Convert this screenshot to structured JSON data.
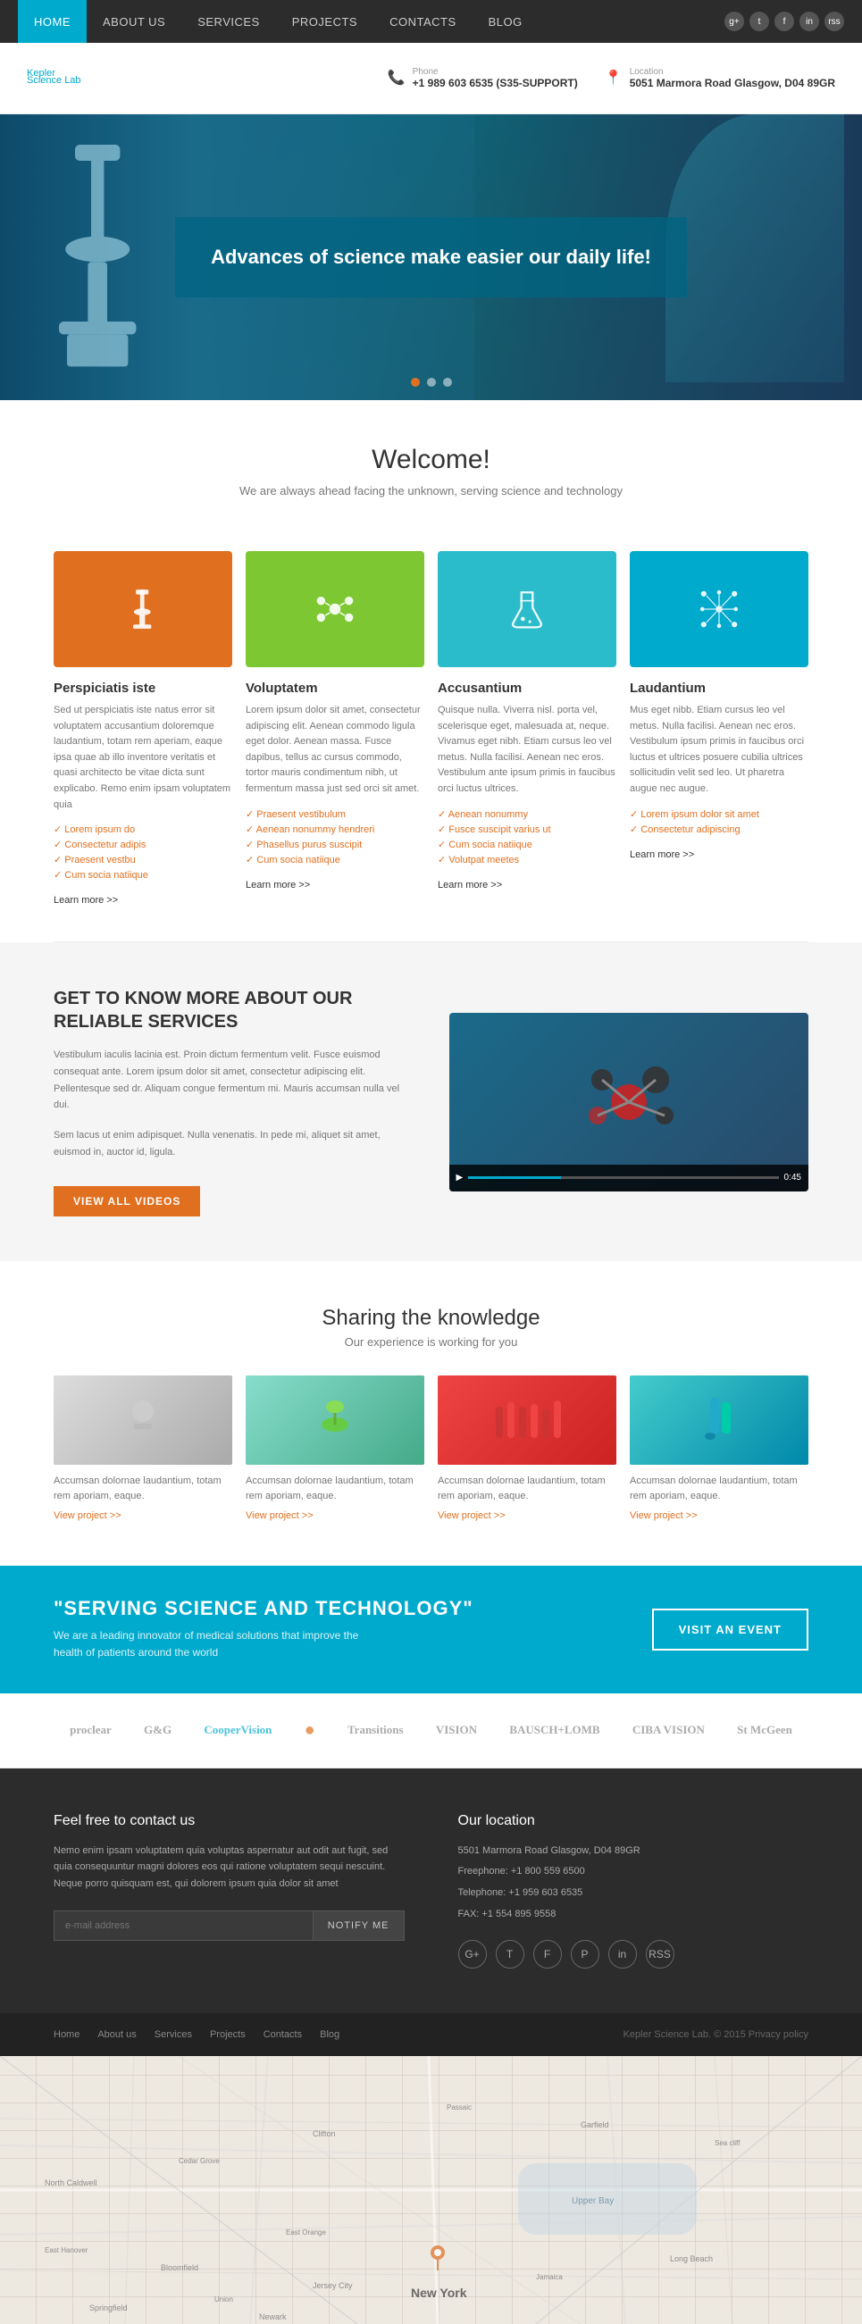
{
  "nav": {
    "items": [
      {
        "label": "HOME",
        "active": true
      },
      {
        "label": "ABOUT US",
        "active": false
      },
      {
        "label": "SERVICES",
        "active": false
      },
      {
        "label": "PROJECTS",
        "active": false
      },
      {
        "label": "CONTACTS",
        "active": false
      },
      {
        "label": "BLOG",
        "active": false
      }
    ],
    "social": [
      "g+",
      "t",
      "f",
      "in",
      "rss"
    ]
  },
  "header": {
    "logo": "Kepler",
    "logo_sub": "Science Lab",
    "phone_label": "Phone",
    "phone": "+1 989 603 6535 (S35-SUPPORT)",
    "location_label": "Location",
    "location": "5051 Marmora Road Glasgow, D04 89GR"
  },
  "hero": {
    "text": "Advances of science make easier our daily life!",
    "dots": [
      true,
      false,
      false
    ]
  },
  "welcome": {
    "title": "Welcome!",
    "subtitle": "We are always ahead facing the unknown, serving science and technology"
  },
  "services": [
    {
      "title": "Perspiciatis iste",
      "icon": "microscope",
      "color": "orange",
      "desc": "Sed ut perspiciatis iste natus error sit voluptatem accusantium doloremque laudantium, totam rem aperiam, eaque ipsa quae ab illo inventore veritatis et quasi architecto be vitae dicta sunt explicabo. Remo enim ipsam voluptatem quia",
      "list": [
        "Lorem ipsum do",
        "Consectetur adipis",
        "Praesent vestbu",
        "Cum socia natiique"
      ],
      "learn_more": "Learn more >>"
    },
    {
      "title": "Voluptatem",
      "icon": "molecule",
      "color": "green",
      "desc": "Lorem ipsum dolor sit amet, consectetur adipiscing elit. Aenean commodo ligula eget dolor. Aenean massa. Fusce dapibus, tellus ac cursus commodo, tortor mauris condimentum nibh, ut fermentum massa just sed orci sit amet.",
      "list": [
        "Praesent vestibulum",
        "Aenean nonummy hendreri",
        "Phasellus purus suscipit",
        "Cum socia natiique"
      ],
      "learn_more": "Learn more >>"
    },
    {
      "title": "Accusantium",
      "icon": "flask",
      "color": "teal",
      "desc": "Quisque nulla. Viverra nisl. porta vel, scelerisque eget, malesuada at, neque. Vivamus eget nibh. Etiam cursus leo vel metus. Nulla facilisi. Aenean nec eros. Vestibulum ante ipsum primis in faucibus orci luctus ultrices.",
      "list": [
        "Aenean nonummy",
        "Fusce suscipit varius ut",
        "Cum socia natiique",
        "Volutpat meetes"
      ],
      "learn_more": "Learn more >>"
    },
    {
      "title": "Laudantium",
      "icon": "network",
      "color": "blue",
      "desc": "Mus eget nibb. Etiam cursus leo vel metus. Nulla facilisi. Aenean nec eros. Vestibulum ipsum primis in faucibus orci luctus et ultrices posuere cubilia ultrices sollicitudin velit sed leo. Ut pharetra augue nec augue.",
      "list": [
        "Lorem ipsum dolor sit amet",
        "Consectetur adipiscing"
      ],
      "learn_more": "Learn more >>"
    }
  ],
  "video_section": {
    "title": "GET TO KNOW MORE\nABOUT OUR RELIABLE SERVICES",
    "desc1": "Vestibulum iaculis lacinia est. Proin dictum fermentum velit. Fusce euismod consequat ante. Lorem ipsum dolor sit amet, consectetur adipiscing elit. Pellentesque sed dr. Aliquam congue fermentum mi. Mauris accumsan nulla vel dui.",
    "desc2": "Sem lacus ut enim adipisquet. Nulla venenatis. In pede mi, aliquet sit amet, euismod in, auctor id, ligula.",
    "button": "VIEW ALL VIDEOS"
  },
  "knowledge": {
    "title": "Sharing the knowledge",
    "subtitle": "Our experience is working for you",
    "projects": [
      {
        "desc": "Accumsan dolornae laudantium, totam rem aporiam, eaque.",
        "link": "View project >>"
      },
      {
        "desc": "Accumsan dolornae laudantium, totam rem aporiam, eaque.",
        "link": "View project >>"
      },
      {
        "desc": "Accumsan dolornae laudantium, totam rem aporiam, eaque.",
        "link": "View project >>"
      },
      {
        "desc": "Accumsan dolornae laudantium, totam rem aporiam, eaque.",
        "link": "View project >>"
      }
    ]
  },
  "cta": {
    "title": "\"SERVING SCIENCE AND TECHNOLOGY\"",
    "desc": "We are a leading innovator of medical solutions that improve the health of patients around the world",
    "button": "VISIT AN EVENT"
  },
  "brands": [
    "proclear",
    "G&G",
    "CooperVision",
    "●",
    "Transitions",
    "VISION",
    "BAUSCH+LOMB",
    "CIBA VISION",
    "St McGeen"
  ],
  "footer": {
    "contact_title": "Feel free to contact us",
    "contact_desc": "Nemo enim ipsam voluptatem quia voluptas aspernatur aut odit aut fugit, sed quia consequuntur magni dolores eos qui ratione voluptatem sequi nescuint. Neque porro quisquam est, qui dolorem ipsum quia dolor sit amet",
    "email_placeholder": "e-mail address",
    "notify_button": "NOTIFY ME",
    "location_title": "Our location",
    "address": "5501 Marmora Road\nGlasgow, D04 89GR",
    "freephone_label": "Freephone",
    "freephone": "+1 800 559 6500",
    "telephone_label": "Telephone",
    "telephone": "+1 959 603 6535",
    "fax_label": "FAX",
    "fax": "+1 554 895 9558",
    "social": [
      "G+",
      "T",
      "F",
      "P",
      "in",
      "RSS"
    ]
  },
  "footer_nav": {
    "links": [
      "Home",
      "About us",
      "Services",
      "Projects",
      "Contacts",
      "Blog"
    ],
    "copyright": "Kepler Science Lab. © 2015 Privacy policy"
  },
  "map": {
    "city": "New York"
  }
}
